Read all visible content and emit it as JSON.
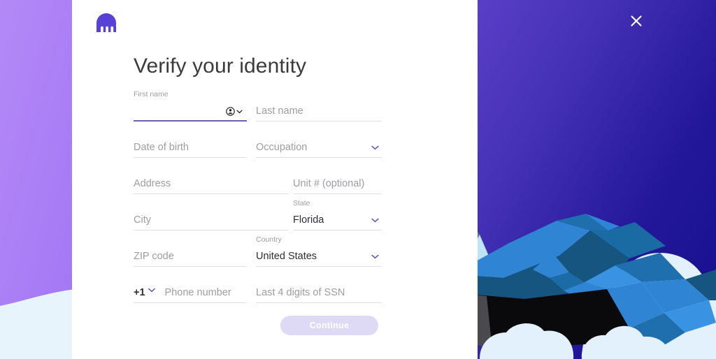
{
  "brand": {
    "logo_icon": "kraken-octopus-logo",
    "logo_color": "#5741d9"
  },
  "page": {
    "heading": "Verify your identity"
  },
  "close": {
    "icon": "close-icon",
    "label": "Close"
  },
  "form": {
    "fields": [
      {
        "key": "first_name",
        "placeholder": "First name",
        "value": "",
        "label": "First name",
        "state": "focused",
        "has_autofill_icon": true
      },
      {
        "key": "last_name",
        "placeholder": "Last name",
        "value": "",
        "state": "empty"
      },
      {
        "key": "date_of_birth",
        "placeholder": "Date of birth",
        "value": "",
        "state": "empty"
      },
      {
        "key": "occupation",
        "placeholder": "Occupation",
        "value": "",
        "state": "empty",
        "type": "select"
      },
      {
        "key": "address",
        "placeholder": "Address",
        "value": "",
        "state": "empty"
      },
      {
        "key": "unit",
        "placeholder": "Unit # (optional)",
        "value": "",
        "state": "empty"
      },
      {
        "key": "city",
        "placeholder": "City",
        "value": "",
        "state": "empty"
      },
      {
        "key": "state",
        "label": "State",
        "value": "Florida",
        "state": "filled",
        "type": "select"
      },
      {
        "key": "zip",
        "placeholder": "ZIP code",
        "value": "",
        "state": "empty"
      },
      {
        "key": "country",
        "label": "Country",
        "value": "United States",
        "state": "filled",
        "type": "select"
      },
      {
        "key": "phone_prefix",
        "value": "+1",
        "state": "filled",
        "type": "select"
      },
      {
        "key": "phone_number",
        "placeholder": "Phone number",
        "value": "",
        "state": "empty"
      },
      {
        "key": "ssn",
        "placeholder": "Last 4 digits of SSN",
        "value": "",
        "state": "empty"
      }
    ],
    "labels": {
      "first_name": "First name",
      "last_name": "Last name",
      "date_of_birth": "Date of birth",
      "occupation": "Occupation",
      "address": "Address",
      "unit": "Unit # (optional)",
      "city": "City",
      "state_label": "State",
      "state_value": "Florida",
      "zip": "ZIP code",
      "country_label": "Country",
      "country_value": "United States",
      "phone_prefix": "+1",
      "phone_number": "Phone number",
      "ssn": "Last 4 digits of SSN"
    },
    "autofill_icon": "person-badge-autofill-icon",
    "chevron_icon": "chevron-down-icon"
  },
  "actions": {
    "continue_label": "Continue",
    "continue_state": "disabled"
  },
  "colors": {
    "accent_purple": "#5741d9",
    "chevron_purple": "#5c4fc0",
    "left_panel_purple": "#a77cf5",
    "left_panel_wave": "#e7f4fb",
    "right_gradient_from": "#4a34b5",
    "right_gradient_to": "#171093",
    "button_disabled_bg": "#ded9f5",
    "placeholder_text": "#9d9da6",
    "value_text": "#2f2f33",
    "heading_text": "#3b3b3d",
    "underline": "#e2e2e6",
    "focus_underline": "#6a62b8"
  }
}
